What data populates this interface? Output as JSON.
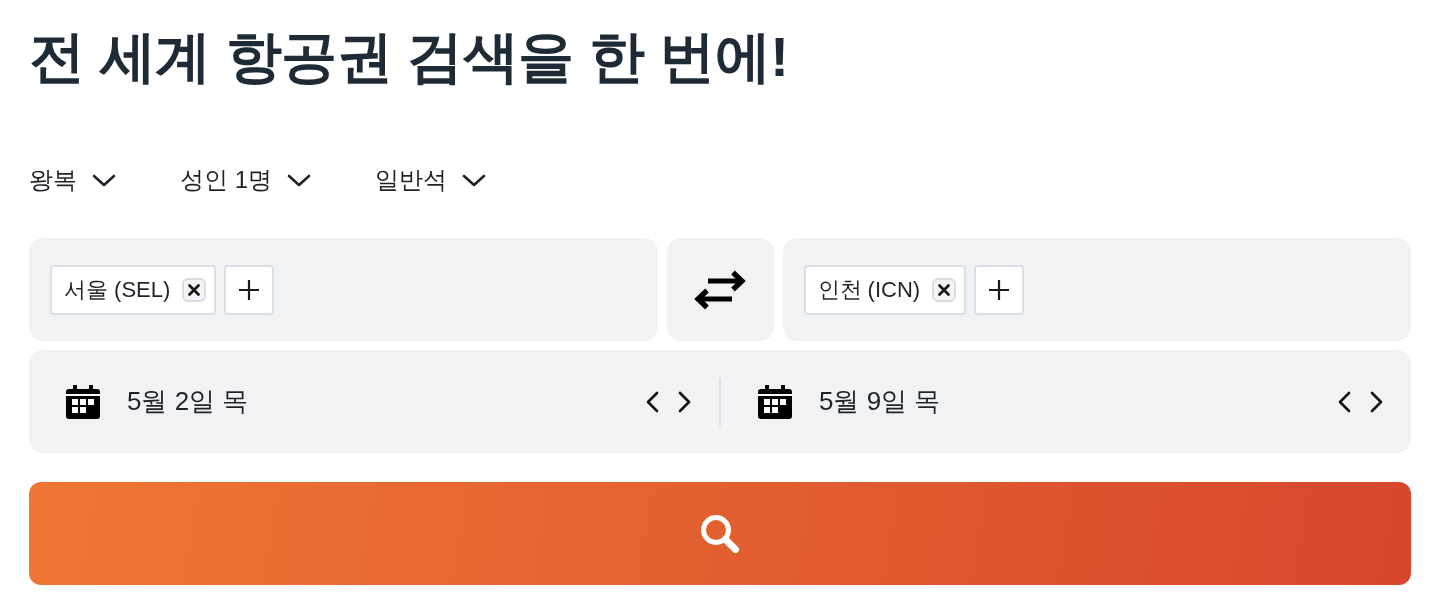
{
  "title": "전 세계 항공권 검색을 한 번에!",
  "options": [
    {
      "label": "왕복"
    },
    {
      "label": "성인 1명"
    },
    {
      "label": "일반석"
    }
  ],
  "route": {
    "origin": {
      "chips": [
        {
          "label": "서울 (SEL)"
        }
      ]
    },
    "destination": {
      "chips": [
        {
          "label": "인천 (ICN)"
        }
      ]
    }
  },
  "dates": [
    {
      "label": "5월 2일 목"
    },
    {
      "label": "5월 9일 목"
    }
  ]
}
